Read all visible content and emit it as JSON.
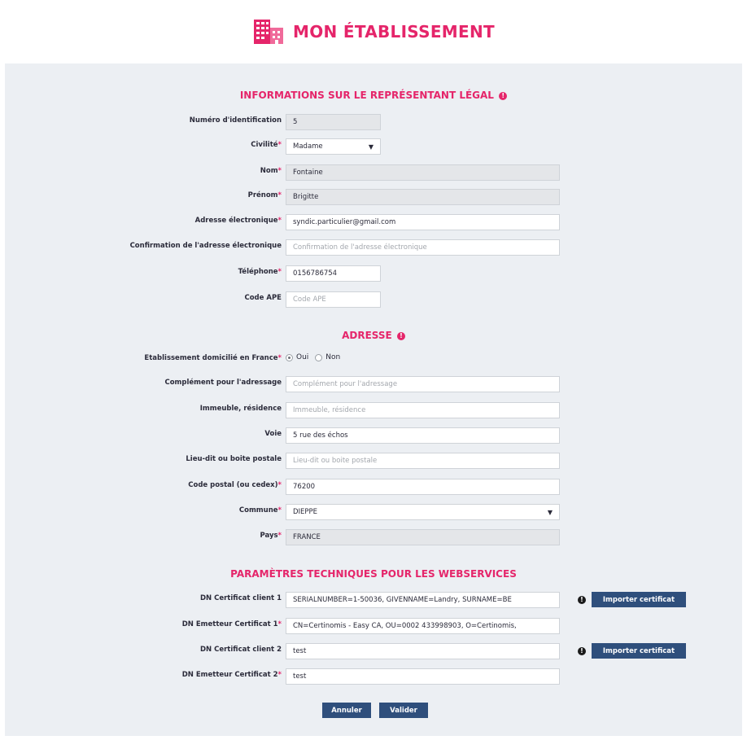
{
  "header": {
    "title": "MON ÉTABLISSEMENT",
    "logo_icon": "building-icon",
    "accent_color": "#e5256a"
  },
  "sections": {
    "legal": {
      "title": "INFORMATIONS SUR LE REPRÉSENTANT LÉGAL",
      "info_glyph": "!"
    },
    "address": {
      "title": "ADRESSE",
      "info_glyph": "!"
    },
    "webservices": {
      "title": "PARAMÈTRES TECHNIQUES POUR LES WEBSERVICES"
    }
  },
  "legal": {
    "id_label": "Numéro d'identification",
    "id_value": "5",
    "civility_label": "Civilité",
    "civility_value": "Madame",
    "lastname_label": "Nom",
    "lastname_value": "Fontaine",
    "firstname_label": "Prénom",
    "firstname_value": "Brigitte",
    "email_label": "Adresse électronique",
    "email_value": "syndic.particulier@gmail.com",
    "email_confirm_label": "Confirmation de l'adresse électronique",
    "email_confirm_placeholder": "Confirmation de l'adresse électronique",
    "phone_label": "Téléphone",
    "phone_value": "0156786754",
    "ape_label": "Code APE",
    "ape_placeholder": "Code APE"
  },
  "address": {
    "france_label": "Etablissement domicilié en France",
    "france_yes": "Oui",
    "france_no": "Non",
    "france_selected": "Oui",
    "complement_label": "Complément pour l'adressage",
    "complement_placeholder": "Complément pour l'adressage",
    "building_label": "Immeuble, résidence",
    "building_placeholder": "Immeuble, résidence",
    "street_label": "Voie",
    "street_value": "5 rue des échos",
    "locality_label": "Lieu-dit ou boite postale",
    "locality_placeholder": "Lieu-dit ou boite postale",
    "postal_label": "Code postal (ou cedex)",
    "postal_value": "76200",
    "city_label": "Commune",
    "city_value": "DIEPPE",
    "country_label": "Pays",
    "country_value": "FRANCE"
  },
  "webservices": {
    "cert1_label": "DN Certificat client 1",
    "cert1_value": "SERIALNUMBER=1-50036, GIVENNAME=Landry, SURNAME=BE",
    "issuer1_label": "DN Emetteur Certificat 1",
    "issuer1_value": "CN=Certinomis - Easy CA, OU=0002 433998903, O=Certinomis,",
    "cert2_label": "DN Certificat client 2",
    "cert2_value": "test",
    "issuer2_label": "DN Emetteur Certificat 2",
    "issuer2_value": "test",
    "import_label": "Importer certificat",
    "info_glyph": "!"
  },
  "actions": {
    "cancel_label": "Annuler",
    "submit_label": "Valider",
    "button_color": "#2f4f7c"
  },
  "required_marker": "*"
}
